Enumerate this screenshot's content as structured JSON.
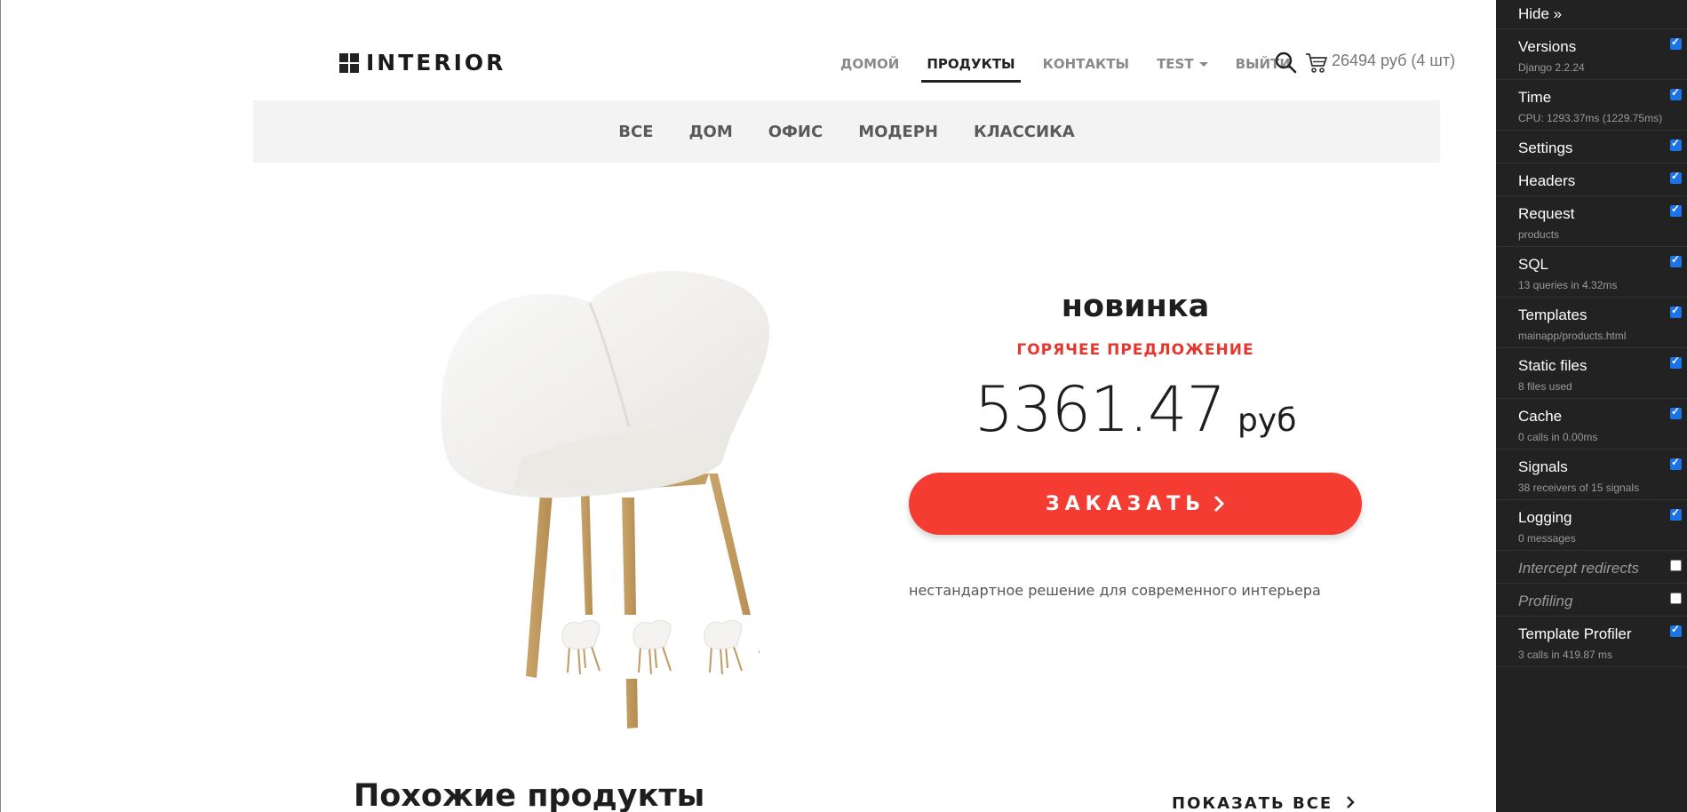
{
  "header": {
    "logo_text": "INTERIOR",
    "nav": [
      "ДОМОЙ",
      "ПРОДУКТЫ",
      "КОНТАКТЫ",
      "TEST",
      "ВЫЙТИ"
    ],
    "active_nav": "ПРОДУКТЫ",
    "cart_text": "26494 руб (4 шт)"
  },
  "categories": [
    "ВСЕ",
    "ДОМ",
    "ОФИС",
    "МОДЕРН",
    "КЛАССИКА"
  ],
  "product": {
    "name": "новинка",
    "hot_label": "ГОРЯЧЕЕ ПРЕДЛОЖЕНИЕ",
    "price": "5361.47",
    "currency": "руб",
    "order_label": "ЗАКАЗАТЬ",
    "description": "нестандартное решение для современного интерьера"
  },
  "related": {
    "title": "Похожие продукты",
    "show_all": "ПОКАЗАТЬ ВСЕ"
  },
  "debug_toolbar": {
    "hide_label": "Hide »",
    "panels": [
      {
        "title": "Versions",
        "sub": "Django 2.2.24",
        "checked": true
      },
      {
        "title": "Time",
        "sub": "CPU: 1293.37ms (1229.75ms)",
        "checked": true
      },
      {
        "title": "Settings",
        "sub": "",
        "checked": true
      },
      {
        "title": "Headers",
        "sub": "",
        "checked": true
      },
      {
        "title": "Request",
        "sub": "products",
        "checked": true
      },
      {
        "title": "SQL",
        "sub": "13 queries in 4.32ms",
        "checked": true
      },
      {
        "title": "Templates",
        "sub": "mainapp/products.html",
        "checked": true
      },
      {
        "title": "Static files",
        "sub": "8 files used",
        "checked": true
      },
      {
        "title": "Cache",
        "sub": "0 calls in 0.00ms",
        "checked": true
      },
      {
        "title": "Signals",
        "sub": "38 receivers of 15 signals",
        "checked": true
      },
      {
        "title": "Logging",
        "sub": "0 messages",
        "checked": true
      },
      {
        "title": "Intercept redirects",
        "sub": "",
        "checked": false
      },
      {
        "title": "Profiling",
        "sub": "",
        "checked": false
      },
      {
        "title": "Template Profiler",
        "sub": "3 calls in 419.87 ms",
        "checked": true
      }
    ]
  },
  "colors": {
    "accent": "#f43c33",
    "toolbar_bg": "#222222"
  },
  "icons": [
    "search-icon",
    "cart-icon",
    "chevron-right-icon"
  ]
}
